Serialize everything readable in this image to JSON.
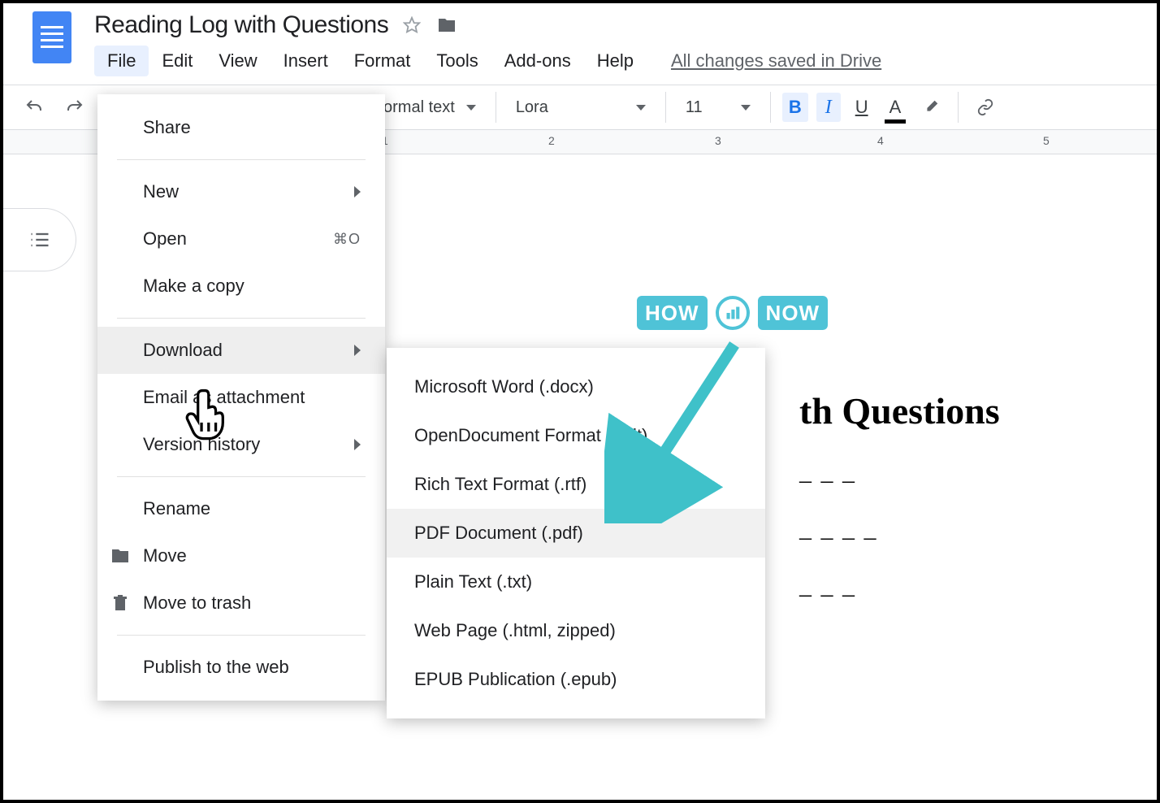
{
  "document": {
    "title": "Reading Log with Questions"
  },
  "menubar": {
    "items": [
      "File",
      "Edit",
      "View",
      "Insert",
      "Format",
      "Tools",
      "Add-ons",
      "Help"
    ],
    "save_status": "All changes saved in Drive"
  },
  "toolbar": {
    "style_select": "ormal text",
    "font_select": "Lora",
    "font_size": "11"
  },
  "ruler": {
    "marks": [
      "1",
      "2",
      "3",
      "4",
      "5"
    ]
  },
  "file_menu": {
    "share": "Share",
    "new": "New",
    "open": "Open",
    "open_shortcut": "⌘O",
    "make_copy": "Make a copy",
    "download": "Download",
    "email_attachment": "Email as attachment",
    "version_history": "Version history",
    "rename": "Rename",
    "move": "Move",
    "move_trash": "Move to trash",
    "publish": "Publish to the web"
  },
  "download_submenu": {
    "items": [
      "Microsoft Word (.docx)",
      "OpenDocument Format (.odt)",
      "Rich Text Format (.rtf)",
      "PDF Document (.pdf)",
      "Plain Text (.txt)",
      "Web Page (.html, zipped)",
      "EPUB Publication (.epub)"
    ],
    "hovered_index": 3
  },
  "canvas": {
    "watermark_left": "HOW",
    "watermark_right": "NOW",
    "heading_visible": "th Questions",
    "dash1": "– – –",
    "dash2": "– – – –",
    "dash3": "– – –"
  }
}
